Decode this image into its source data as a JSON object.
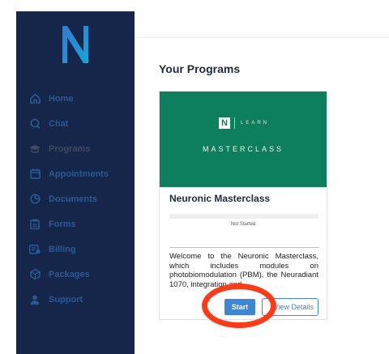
{
  "sidebar": {
    "collapse_glyph": "‹",
    "logo_letter": "N",
    "items": [
      {
        "label": "Home",
        "icon": "home-icon"
      },
      {
        "label": "Chat",
        "icon": "chat-icon"
      },
      {
        "label": "Programs",
        "icon": "graduation-cap-icon"
      },
      {
        "label": "Appointments",
        "icon": "calendar-icon"
      },
      {
        "label": "Documents",
        "icon": "document-icon"
      },
      {
        "label": "Forms",
        "icon": "clipboard-icon"
      },
      {
        "label": "Billing",
        "icon": "billing-icon"
      },
      {
        "label": "Packages",
        "icon": "package-icon"
      },
      {
        "label": "Support",
        "icon": "user-icon"
      }
    ],
    "active": "Programs",
    "bg_color": "#15264a",
    "item_color": "#2a5a93"
  },
  "main": {
    "heading": "Your Programs"
  },
  "program_card": {
    "banner": {
      "logo_letter": "N",
      "brand_word": "LEARN",
      "title": "MASTERCLASS",
      "color": "#0e7f5e"
    },
    "title": "Neuronic Masterclass",
    "status": "Not Started",
    "progress": 0,
    "description": "Welcome to the Neuronic Masterclass, which includes modules on photobiomodulation (PBM), the Neuradiant 1070, integration and",
    "start_label": "Start",
    "view_details_label": "View Details",
    "accent_color": "#3d86d6"
  },
  "annotation": {
    "highlight_color": "#ff3b17",
    "target": "start-button"
  }
}
